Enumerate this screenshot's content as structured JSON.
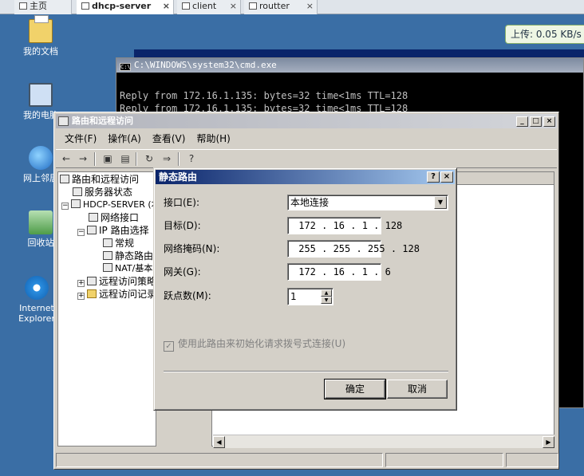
{
  "tabs": [
    {
      "label": "主页"
    },
    {
      "label": "dhcp-server"
    },
    {
      "label": "client"
    },
    {
      "label": "routter"
    }
  ],
  "upload": {
    "label": "上传: 0.05 KB/s"
  },
  "desktop_icons": [
    {
      "label": "我的文档",
      "icon": "my-documents-icon"
    },
    {
      "label": "我的电脑",
      "icon": "my-computer-icon"
    },
    {
      "label": "网上邻居",
      "icon": "network-places-icon"
    },
    {
      "label": "回收站",
      "icon": "recycle-bin-icon"
    },
    {
      "label": "Internet Explorer",
      "icon": "internet-explorer-icon"
    }
  ],
  "cmd": {
    "title": "C:\\WINDOWS\\system32\\cmd.exe",
    "lines": [
      "Reply from 172.16.1.135: bytes=32 time<1ms TTL=128",
      "Reply from 172.16.1.135: bytes=32 time<1ms TTL=128"
    ]
  },
  "mmc": {
    "title": "路由和远程访问",
    "menu": [
      "文件(F)",
      "操作(A)",
      "查看(V)",
      "帮助(H)"
    ],
    "tree": [
      {
        "label": "路由和远程访问"
      },
      {
        "label": "服务器状态"
      },
      {
        "label": "HDCP-SERVER (本"
      },
      {
        "label": "网络接口"
      },
      {
        "label": "IP 路由选择"
      },
      {
        "label": "常规"
      },
      {
        "label": "静态路由"
      },
      {
        "label": "NAT/基本"
      },
      {
        "label": "远程访问策略"
      },
      {
        "label": "远程访问记录"
      }
    ]
  },
  "dialog": {
    "title": "静态路由",
    "help_btn": "?",
    "close_btn": "×",
    "interface_label": "接口(E):",
    "interface_value": "本地连接",
    "target_label": "目标(D):",
    "target_value": " 172 . 16 . 1 . 128",
    "mask_label": "网络掩码(N):",
    "mask_value": " 255 . 255 . 255 . 128",
    "gateway_label": "网关(G):",
    "gateway_value": " 172 . 16 . 1 . 6",
    "hops_label": "跃点数(M):",
    "hops_value": "1",
    "checkbox_label": "使用此路由来初始化请求拨号式连接(U)",
    "checkbox_checked": true,
    "ok": "确定",
    "cancel": "取消"
  }
}
